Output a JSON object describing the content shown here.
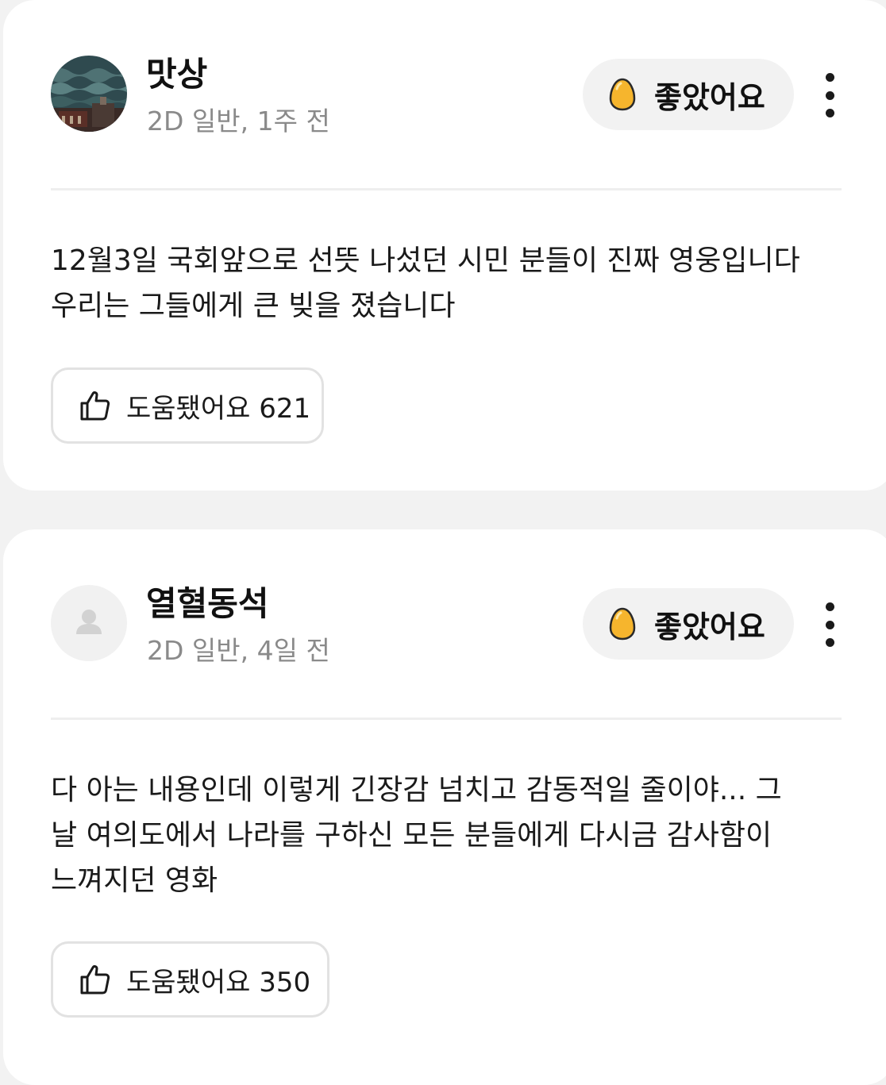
{
  "reviews": [
    {
      "avatar": "profile-photo",
      "username": "맛상",
      "meta": "2D 일반, 1주 전",
      "rating_label": "좋았어요",
      "rating_icon": "golden-egg-icon",
      "body": "12월3일 국회앞으로 선뜻 나섰던 시민 분들이 진짜 영웅입니다\n우리는 그들에게 큰 빚을 졌습니다",
      "helpful_label": "도움됐어요 621"
    },
    {
      "avatar": "default-user-icon",
      "username": "열혈동석",
      "meta": "2D 일반, 4일 전",
      "rating_label": "좋았어요",
      "rating_icon": "golden-egg-icon",
      "body": "다 아는 내용인데 이렇게 긴장감 넘치고 감동적일 줄이야... 그\n날 여의도에서 나라를 구하신 모든 분들에게 다시금 감사함이\n느껴지던 영화",
      "helpful_label": "도움됐어요 350"
    }
  ],
  "colors": {
    "page_background": "#f2f2f2",
    "card_background": "#ffffff",
    "meta_text": "#8a8a8a",
    "egg_fill": "#f6b52d",
    "pill_background": "#f2f2f2"
  }
}
